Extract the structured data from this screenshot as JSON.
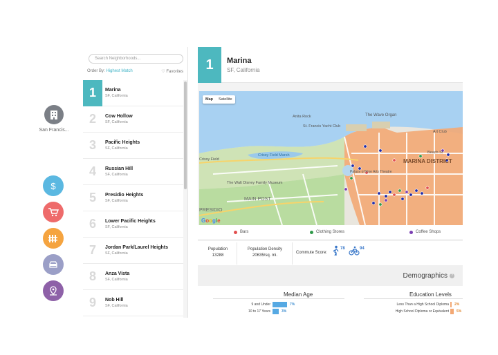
{
  "city": {
    "label": "San Francis..."
  },
  "rail_icons": [
    "dollar-icon",
    "cart-icon",
    "fence-icon",
    "car-icon",
    "location-pin-icon"
  ],
  "rail_colors": [
    "#5bb8e1",
    "#ee6b6b",
    "#f5a440",
    "#9b9fc7",
    "#8e61a8"
  ],
  "search": {
    "placeholder": "Search Neighborhoods..."
  },
  "order": {
    "label": "Order By:",
    "value": "Highest Match",
    "favorites": "Favorites"
  },
  "neighborhoods": [
    {
      "rank": "1",
      "name": "Marina",
      "sub": "SF, California"
    },
    {
      "rank": "2",
      "name": "Cow Hollow",
      "sub": "SF, California"
    },
    {
      "rank": "3",
      "name": "Pacific Heights",
      "sub": "SF, California"
    },
    {
      "rank": "4",
      "name": "Russian Hill",
      "sub": "SF, California"
    },
    {
      "rank": "5",
      "name": "Presidio Heights",
      "sub": "SF, California"
    },
    {
      "rank": "6",
      "name": "Lower Pacific Heights",
      "sub": "SF, California"
    },
    {
      "rank": "7",
      "name": "Jordan Park/Laurel Heights",
      "sub": "SF, California"
    },
    {
      "rank": "8",
      "name": "Anza Vista",
      "sub": "SF, California"
    },
    {
      "rank": "9",
      "name": "Nob Hill",
      "sub": "SF, California"
    }
  ],
  "detail": {
    "rank": "1",
    "title": "Marina",
    "sub": "SF, California"
  },
  "map": {
    "toggle_map": "Map",
    "toggle_satellite": "Satellite",
    "labels": {
      "wave_organ": "The Wave Organ",
      "anita_rock": "Anita Rock",
      "yacht_club": "St. Francis Yacht Club",
      "crissy_marsh": "Crissy Field Marsh",
      "crissy_field": "Crissy Field",
      "palace": "Palace of Fine Arts Theatre",
      "disney": "The Walt Disney Family Museum",
      "main_post": "MAIN POST",
      "presidio": "PRESIDIO",
      "district": "MARINA DISTRICT",
      "beach_st": "Beach St",
      "art_club": "Art Club",
      "google": "Google"
    }
  },
  "legend": [
    {
      "label": "Bars",
      "color": "#e2504f"
    },
    {
      "label": "Clothing Stores",
      "color": "#2f9a4a"
    },
    {
      "label": "Coffee Shops",
      "color": "#7b3fb3"
    }
  ],
  "stats": {
    "population_label": "Population",
    "population_value": "13288",
    "density_label": "Population Density",
    "density_value": "20635/sq. mi.",
    "commute_label": "Commute Score:",
    "walk_score": "78",
    "bike_score": "94"
  },
  "demographics": {
    "title": "Demographics",
    "median_age": {
      "title": "Median Age",
      "rows": [
        {
          "label": "9 and Under",
          "pct": "7%",
          "value": 7
        },
        {
          "label": "10 to 17 Years",
          "pct": "3%",
          "value": 3
        }
      ]
    },
    "education": {
      "title": "Education Levels",
      "rows": [
        {
          "label": "Less Than a High School Diploma",
          "pct": "2%",
          "value": 2
        },
        {
          "label": "High School Diploma or Equivalent",
          "pct": "5%",
          "value": 5
        }
      ]
    }
  }
}
